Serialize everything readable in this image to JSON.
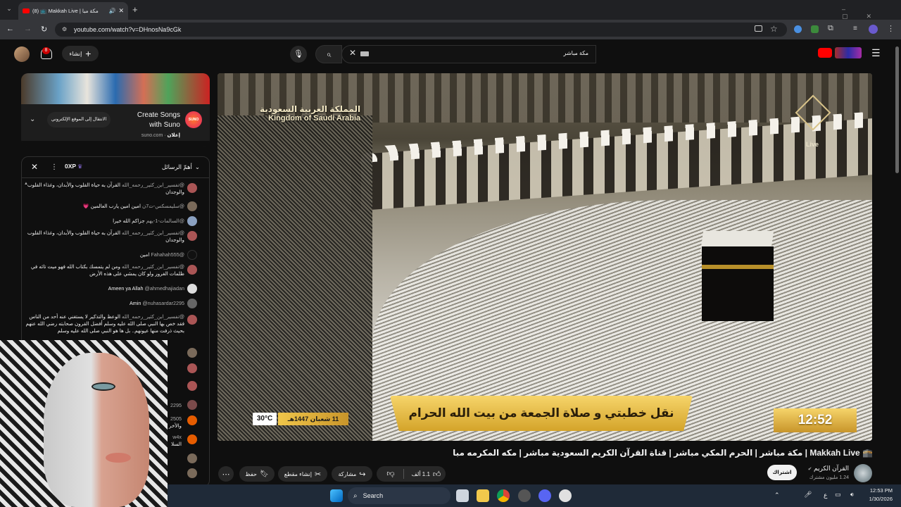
{
  "browser": {
    "tab_title": "(8) 📺 Makkah Live | مكة مبا",
    "url": "youtube.com/watch?v=DHnosNa9cGk"
  },
  "masthead": {
    "notif_count": "8",
    "create_label": "إنشاء",
    "search_value": "مكة مباشر"
  },
  "ad": {
    "title_line1": "Create Songs",
    "title_line2": "with Suno",
    "sponsored": "إعلان",
    "domain": "suno.com",
    "cta": "الانتقال إلى الموقع الإلكتروني",
    "brand": "SUNO"
  },
  "chat": {
    "mode_label": "أهمّ الرسائل",
    "xp": "0XP",
    "messages": [
      {
        "author": "@تفسير_ابن_كثير_رحمه_الله",
        "text": "القرآن به حياة القلوب والأبدان، وغذاء القلوب والوجدان"
      },
      {
        "author": "@سليمسكس-ت7ن",
        "text": "امين امين يارب العالمين 💗"
      },
      {
        "author": "@السالمات-1-يهم",
        "text": "جزاكم الله خيرا"
      },
      {
        "author": "@تفسير_ابن_كثير_رحمه_الله",
        "text": "القرآن به حياة القلوب والأبدان، وغذاء القلوب والوجدان"
      },
      {
        "author": "@Fahahah555",
        "text": "امين"
      },
      {
        "author": "@تفسير_ابن_كثير_رحمه_الله",
        "text": "ومن لم يتمسك بكتاب الله فهو ميت تائه في ظلمات الغرور ولو كان يمشي على هذه الأرض"
      },
      {
        "author": "@ahmedhajiadan",
        "text": "Ameen ya Allah"
      },
      {
        "author": "@nuhasardar2295",
        "text": "Amin"
      },
      {
        "author": "@تفسير_ابن_كثير_رحمه_الله",
        "text": "الوعظ والتذكير لا يستغني عنه أحد من الناس فقد خص بها النبي صلى الله عليه وسلم أفضل القرون صحابته رضي الله عنهم بحيث ذرفت منها عيونهم.. بل ها هو النبي صلى الله عليه وسلم"
      },
      {
        "author": "2295",
        "text": ""
      },
      {
        "author": "2505",
        "text": "والأخر"
      },
      {
        "author": "w4x",
        "text": "السلا"
      }
    ]
  },
  "video": {
    "kingdom_ar": "المملكة العربية السعودية",
    "kingdom_en": "Kingdom of Saudi Arabia",
    "live_badge": "Live",
    "temp": "30°C",
    "date": "11 شعبان 1447هـ",
    "banner": "نقل خطبتي و صلاة الجمعة من بيت الله الحرام",
    "clock": "12:52"
  },
  "watch": {
    "title": "مكة مباشر | الحرم المكي مباشر | قناة القرآن الكريم السعودية مباشر | مكه المكرمه مبا | Makkah Live 🕋",
    "channel": "القرآن الكريم",
    "subs": "1.24 مليون مشترك",
    "subscribe": "اشتراك",
    "likes": "1.1 ألف",
    "share": "مشاركة",
    "clip": "إنشاء مقطع",
    "save": "حفظ"
  },
  "taskbar": {
    "search": "Search",
    "time": "12:53 PM",
    "date": "1/30/2026",
    "lang": "ع"
  },
  "colors": {
    "accent": "#ff0000",
    "gold": "#d4a42a",
    "bg": "#0f0f0f"
  }
}
